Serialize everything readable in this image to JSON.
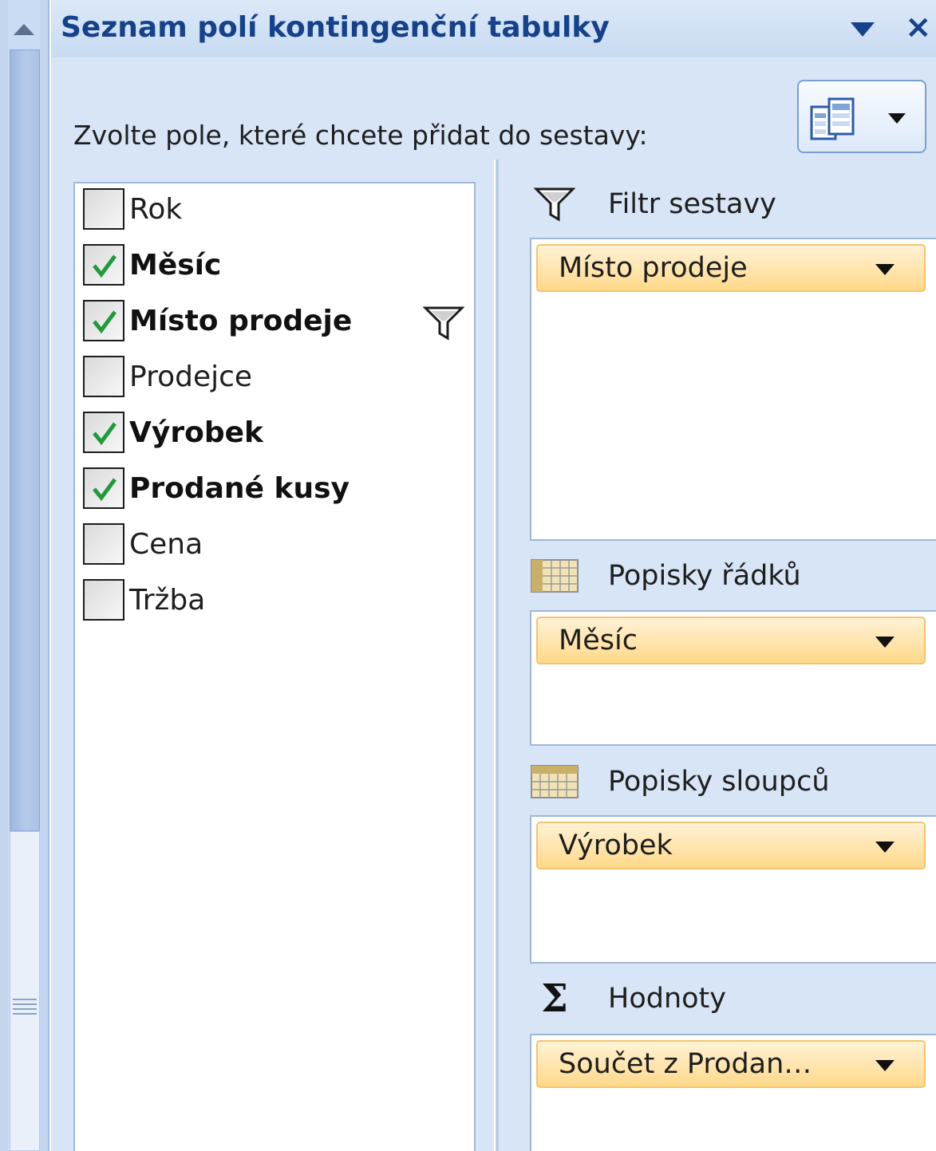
{
  "panel": {
    "title": "Seznam polí kontingenční tabulky",
    "close_glyph": "×",
    "prompt": "Zvolte pole, které chcete přidat do sestavy:",
    "layout_button_icon": "field-list-layout-icon"
  },
  "fields": [
    {
      "label": "Rok",
      "checked": false,
      "bold": false
    },
    {
      "label": "Měsíc",
      "checked": true,
      "bold": true
    },
    {
      "label": "Místo prodeje",
      "checked": true,
      "bold": true,
      "filtered": true
    },
    {
      "label": "Prodejce",
      "checked": false,
      "bold": false
    },
    {
      "label": "Výrobek",
      "checked": true,
      "bold": true
    },
    {
      "label": "Prodané kusy",
      "checked": true,
      "bold": true
    },
    {
      "label": "Cena",
      "checked": false,
      "bold": false
    },
    {
      "label": "Tržba",
      "checked": false,
      "bold": false
    }
  ],
  "areas": {
    "filter": {
      "title": "Filtr sestavy",
      "icon": "filter-icon",
      "chip": "Místo prodeje"
    },
    "rows": {
      "title": "Popisky řádků",
      "icon": "row-grid-icon",
      "chip": "Měsíc"
    },
    "columns": {
      "title": "Popisky sloupců",
      "icon": "column-grid-icon",
      "chip": "Výrobek"
    },
    "values": {
      "title": "Hodnoty",
      "icon": "sigma-icon",
      "sigma": "Σ",
      "chip": "Součet z Prodan…"
    }
  },
  "colors": {
    "title": "#15428b",
    "panel_bg": "#d7e5f6",
    "chip_bg": "#ffd98a",
    "check": "#1f9b3a"
  }
}
